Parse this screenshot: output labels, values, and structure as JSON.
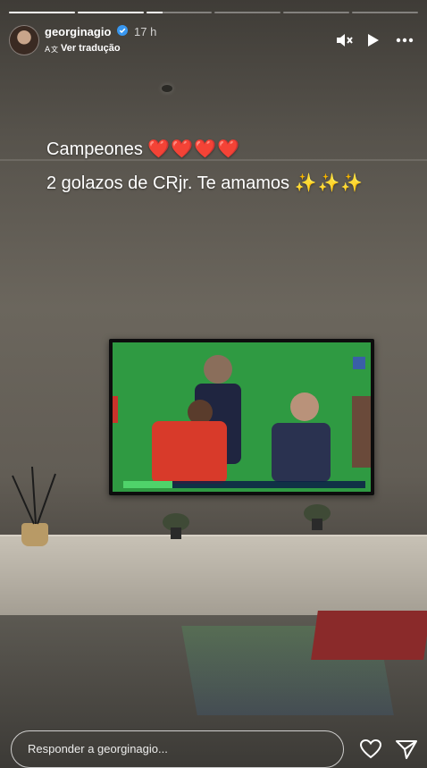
{
  "story": {
    "progress": [
      1,
      1,
      0.25,
      0,
      0,
      0
    ],
    "username": "georginagio",
    "time": "17 h",
    "translate_label": "Ver tradução",
    "controls": [
      "mute-icon",
      "play-icon",
      "more-icon"
    ]
  },
  "caption": {
    "line1_text": "Campeones",
    "line1_emoji": "❤️❤️❤️❤️",
    "line2_text": "2 golazos de CRjr. Te amamos",
    "line2_emoji": "✨✨✨"
  },
  "reply": {
    "placeholder": "Responder a georginagio..."
  },
  "icons": {
    "verified": "verified-badge-icon",
    "translate": "translate-icon",
    "like": "heart-icon",
    "share": "send-icon"
  },
  "colors": {
    "verified": "#3897f0",
    "heart": "#d42a2a"
  }
}
